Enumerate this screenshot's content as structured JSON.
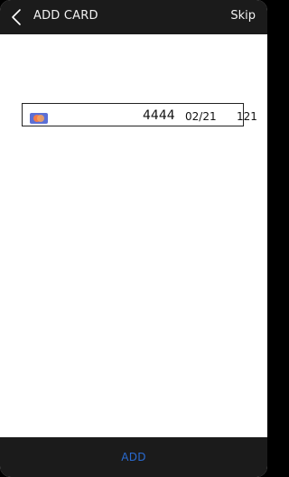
{
  "header": {
    "title": "ADD CARD",
    "skip_label": "Skip",
    "back_icon": "chevron-left-icon"
  },
  "card": {
    "icon": "credit-card-icon",
    "last4": "4444",
    "expiry": "02/21",
    "cvc": "121"
  },
  "footer": {
    "add_label": "ADD"
  },
  "colors": {
    "bar": "#1b1b1b",
    "accent": "#2a6bd1",
    "card_icon_blue": "#5b6fd6",
    "card_icon_orange": "#f27a4a"
  }
}
